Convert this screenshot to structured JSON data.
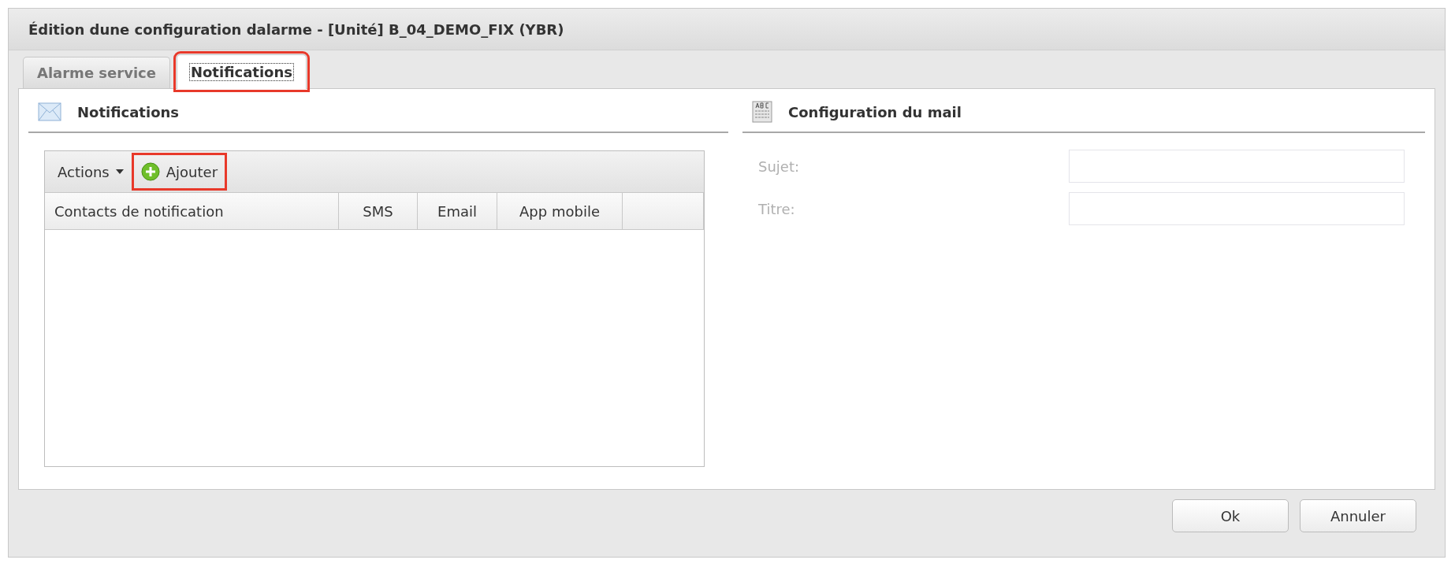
{
  "window": {
    "title": "Édition dune configuration dalarme - [Unité] B_04_DEMO_FIX (YBR)"
  },
  "tabs": [
    {
      "label": "Alarme service",
      "selected": false,
      "highlighted": false
    },
    {
      "label": "Notifications",
      "selected": true,
      "highlighted": true
    }
  ],
  "notifications": {
    "title": "Notifications",
    "toolbar": [
      {
        "kind": "menu",
        "label": "Actions"
      },
      {
        "kind": "add",
        "label": "Ajouter",
        "highlighted": true
      }
    ],
    "table": {
      "columns": [
        "Contacts de notification",
        "SMS",
        "Email",
        "App mobile"
      ]
    }
  },
  "mail_config": {
    "title": "Configuration du mail",
    "fields": [
      {
        "label": "Sujet:",
        "disabled": true
      },
      {
        "label": "Titre:",
        "disabled": true
      }
    ]
  },
  "buttons": [
    "Ok",
    "Annuler"
  ]
}
